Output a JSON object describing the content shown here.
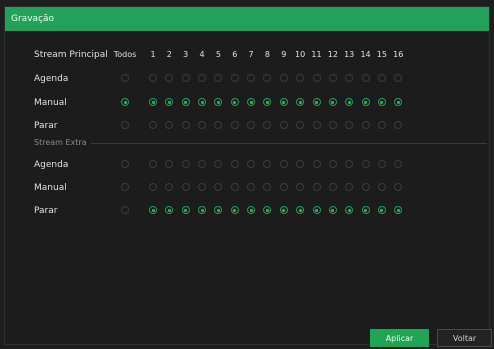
{
  "window": {
    "title": "Gravação"
  },
  "main": {
    "header": {
      "label": "Stream Principal",
      "todos": "Todos",
      "channels": [
        "1",
        "2",
        "3",
        "4",
        "5",
        "6",
        "7",
        "8",
        "9",
        "10",
        "11",
        "12",
        "13",
        "14",
        "15",
        "16"
      ]
    },
    "sections": [
      {
        "title": "",
        "rows": [
          {
            "label": "Agenda",
            "todos": false,
            "channels": [
              false,
              false,
              false,
              false,
              false,
              false,
              false,
              false,
              false,
              false,
              false,
              false,
              false,
              false,
              false,
              false
            ]
          },
          {
            "label": "Manual",
            "todos": true,
            "channels": [
              true,
              true,
              true,
              true,
              true,
              true,
              true,
              true,
              true,
              true,
              true,
              true,
              true,
              true,
              true,
              true
            ]
          },
          {
            "label": "Parar",
            "todos": false,
            "channels": [
              false,
              false,
              false,
              false,
              false,
              false,
              false,
              false,
              false,
              false,
              false,
              false,
              false,
              false,
              false,
              false
            ]
          }
        ]
      },
      {
        "title": "Stream Extra",
        "rows": [
          {
            "label": "Agenda",
            "todos": false,
            "channels": [
              false,
              false,
              false,
              false,
              false,
              false,
              false,
              false,
              false,
              false,
              false,
              false,
              false,
              false,
              false,
              false
            ]
          },
          {
            "label": "Manual",
            "todos": false,
            "channels": [
              false,
              false,
              false,
              false,
              false,
              false,
              false,
              false,
              false,
              false,
              false,
              false,
              false,
              false,
              false,
              false
            ]
          },
          {
            "label": "Parar",
            "todos": false,
            "channels": [
              true,
              true,
              true,
              true,
              true,
              true,
              true,
              true,
              true,
              true,
              true,
              true,
              true,
              true,
              true,
              true
            ]
          }
        ]
      }
    ]
  },
  "footer": {
    "apply_label": "Aplicar",
    "back_label": "Voltar"
  },
  "colors": {
    "accent": "#22a15a",
    "background": "#1c1c1c"
  }
}
